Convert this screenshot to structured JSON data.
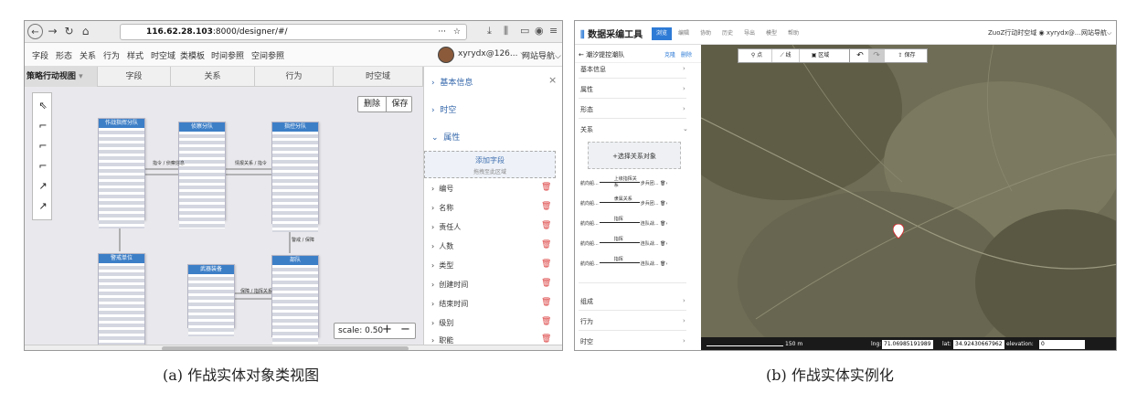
{
  "left": {
    "browser": {
      "url_domain": "116.62.28.103",
      "url_rest": ":8000/designer/#/",
      "menu_dots": "···"
    },
    "menu": [
      "字段",
      "形态",
      "关系",
      "行为",
      "样式",
      "时空域",
      "类模板",
      "时间参照",
      "空间参照"
    ],
    "user": "xyrydx@126... ⌵",
    "site_nav": "网站导航⌵",
    "tabs": [
      "策略行动视图",
      "字段",
      "关系",
      "行为",
      "时空域"
    ],
    "buttons": {
      "delete": "删除",
      "save": "保存"
    },
    "scale_label": "scale:",
    "scale_value": "0.50",
    "zoom_in": "+",
    "zoom_out": "−",
    "entities": [
      "作战指挥分队",
      "侦察分队",
      "指控分队",
      "警戒单位",
      "武器装备",
      "部队"
    ],
    "edge_labels": [
      "指令 / 侦察信息",
      "情报关系 / 指令",
      "保障 / 指挥关系",
      "警戒 / 保障"
    ],
    "panel_sections": {
      "basic": "基本信息",
      "spacetime": "时空",
      "attr": "属性"
    },
    "add_field": "添加字段",
    "add_field_hint": "拖拽至此区域",
    "fields": [
      "编号",
      "名称",
      "责任人",
      "人数",
      "类型",
      "创建时间",
      "结束时间",
      "级别",
      "职能"
    ]
  },
  "right": {
    "app_title": "数据采编工具",
    "tabs": [
      "浏览",
      "编辑",
      "协助",
      "历史",
      "导出",
      "模型",
      "帮助"
    ],
    "user": "ZuoZ行动时空域 ◉ xyrydx@... ",
    "site_nav": "网站导航⌵",
    "sub_title": "← 潮汐提控潮队",
    "sub_actions": [
      "克隆",
      "删除"
    ],
    "map_tools": [
      "点",
      "线",
      "区域"
    ],
    "undo": "↶",
    "redo": "↷",
    "save": "保存",
    "sidebar": [
      "基本信息",
      "属性",
      "形态",
      "关系"
    ],
    "add_relation": "+选择关系对象",
    "relations": [
      {
        "left": "航向船...",
        "label": "上级指挥关系",
        "right": "步兵团..."
      },
      {
        "left": "航向船...",
        "label": "隶属关系",
        "right": "步兵团..."
      },
      {
        "left": "航向船...",
        "label": "指挥",
        "right": "连队战..."
      },
      {
        "left": "航向船...",
        "label": "指挥",
        "right": "连队战..."
      },
      {
        "left": "航向船...",
        "label": "指挥",
        "right": "连队战..."
      }
    ],
    "lower_sections": [
      "组成",
      "行为",
      "时空"
    ],
    "status": {
      "scale": "150 m",
      "lng_label": "lng:",
      "lng": "71.06985191989",
      "lat_label": "lat:",
      "lat": "34.92430667962",
      "elev_label": "elevation:",
      "elev": "0"
    }
  },
  "captions": {
    "a": "(a) 作战实体对象类视图",
    "b": "(b) 作战实体实例化"
  }
}
